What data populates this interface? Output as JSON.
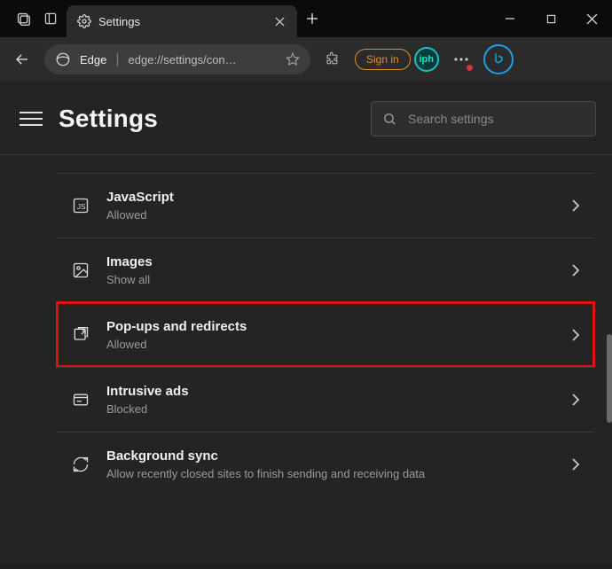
{
  "titlebar": {
    "tab_title": "Settings",
    "tab_icon": "gear-icon",
    "new_tab_label": "+"
  },
  "toolbar": {
    "browser_label": "Edge",
    "url_display": "edge://settings/con…",
    "sign_in_label": "Sign in"
  },
  "settings_header": {
    "title": "Settings",
    "search_placeholder": "Search settings"
  },
  "rows": [
    {
      "icon": "js-icon",
      "title": "JavaScript",
      "sub": "Allowed"
    },
    {
      "icon": "image-icon",
      "title": "Images",
      "sub": "Show all"
    },
    {
      "icon": "popup-icon",
      "title": "Pop-ups and redirects",
      "sub": "Allowed",
      "highlight": true
    },
    {
      "icon": "ads-icon",
      "title": "Intrusive ads",
      "sub": "Blocked"
    },
    {
      "icon": "sync-icon",
      "title": "Background sync",
      "sub": "Allow recently closed sites to finish sending and receiving data"
    }
  ]
}
